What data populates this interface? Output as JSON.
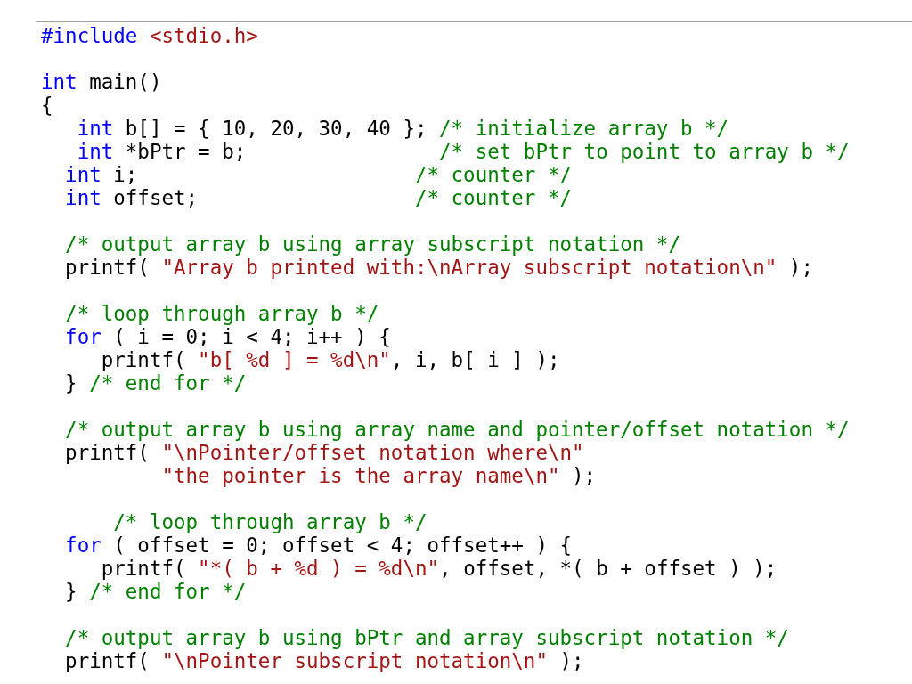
{
  "code_lines": [
    {
      "kind": "code",
      "tokens": [
        {
          "kind": "keyword",
          "text": "#include "
        },
        {
          "kind": "string",
          "text": "<stdio.h>"
        }
      ]
    },
    {
      "kind": "blank"
    },
    {
      "kind": "code",
      "tokens": [
        {
          "kind": "keyword",
          "text": "int"
        },
        {
          "kind": "plain",
          "text": " main()"
        }
      ]
    },
    {
      "kind": "code",
      "tokens": [
        {
          "kind": "plain",
          "text": "{"
        }
      ]
    },
    {
      "kind": "code",
      "tokens": [
        {
          "kind": "keyword",
          "text": "   int"
        },
        {
          "kind": "plain",
          "text": " b[] = { 10, 20, 30, 40 }; "
        },
        {
          "kind": "comment",
          "text": "/* initialize array b */"
        }
      ]
    },
    {
      "kind": "code",
      "tokens": [
        {
          "kind": "keyword",
          "text": "   int"
        },
        {
          "kind": "plain",
          "text": " *bPtr = b;                "
        },
        {
          "kind": "comment",
          "text": "/* set bPtr to point to array b */"
        }
      ]
    },
    {
      "kind": "code",
      "tokens": [
        {
          "kind": "keyword",
          "text": "  int"
        },
        {
          "kind": "plain",
          "text": " i;                       "
        },
        {
          "kind": "comment",
          "text": "/* counter */"
        }
      ]
    },
    {
      "kind": "code",
      "tokens": [
        {
          "kind": "keyword",
          "text": "  int"
        },
        {
          "kind": "plain",
          "text": " offset;                  "
        },
        {
          "kind": "comment",
          "text": "/* counter */"
        }
      ]
    },
    {
      "kind": "blank"
    },
    {
      "kind": "code",
      "tokens": [
        {
          "kind": "comment",
          "text": "  /* output array b using array subscript notation */"
        }
      ]
    },
    {
      "kind": "code",
      "tokens": [
        {
          "kind": "plain",
          "text": "  printf( "
        },
        {
          "kind": "string",
          "text": "\"Array b printed with:\\nArray subscript notation\\n\""
        },
        {
          "kind": "plain",
          "text": " );"
        }
      ]
    },
    {
      "kind": "blank"
    },
    {
      "kind": "code",
      "tokens": [
        {
          "kind": "comment",
          "text": "  /* loop through array b */"
        }
      ]
    },
    {
      "kind": "code",
      "tokens": [
        {
          "kind": "keyword",
          "text": "  for"
        },
        {
          "kind": "plain",
          "text": " ( i = 0; i < 4; i++ ) {"
        }
      ]
    },
    {
      "kind": "code",
      "tokens": [
        {
          "kind": "plain",
          "text": "     printf( "
        },
        {
          "kind": "string",
          "text": "\"b[ %d ] = %d\\n\""
        },
        {
          "kind": "plain",
          "text": ", i, b[ i ] );"
        }
      ]
    },
    {
      "kind": "code",
      "tokens": [
        {
          "kind": "plain",
          "text": "  } "
        },
        {
          "kind": "comment",
          "text": "/* end for */"
        }
      ]
    },
    {
      "kind": "blank"
    },
    {
      "kind": "code",
      "tokens": [
        {
          "kind": "comment",
          "text": "  /* output array b using array name and pointer/offset notation */"
        }
      ]
    },
    {
      "kind": "code",
      "tokens": [
        {
          "kind": "plain",
          "text": "  printf( "
        },
        {
          "kind": "string",
          "text": "\"\\nPointer/offset notation where\\n\""
        }
      ]
    },
    {
      "kind": "code",
      "tokens": [
        {
          "kind": "string",
          "text": "          \"the pointer is the array name\\n\""
        },
        {
          "kind": "plain",
          "text": " );"
        }
      ]
    },
    {
      "kind": "blank"
    },
    {
      "kind": "code",
      "tokens": [
        {
          "kind": "comment",
          "text": "      /* loop through array b */"
        }
      ]
    },
    {
      "kind": "code",
      "tokens": [
        {
          "kind": "keyword",
          "text": "  for"
        },
        {
          "kind": "plain",
          "text": " ( offset = 0; offset < 4; offset++ ) {"
        }
      ]
    },
    {
      "kind": "code",
      "tokens": [
        {
          "kind": "plain",
          "text": "     printf( "
        },
        {
          "kind": "string",
          "text": "\"*( b + %d ) = %d\\n\""
        },
        {
          "kind": "plain",
          "text": ", offset, *( b + offset ) );"
        }
      ]
    },
    {
      "kind": "code",
      "tokens": [
        {
          "kind": "plain",
          "text": "  } "
        },
        {
          "kind": "comment",
          "text": "/* end for */"
        }
      ]
    },
    {
      "kind": "blank"
    },
    {
      "kind": "code",
      "tokens": [
        {
          "kind": "comment",
          "text": "  /* output array b using bPtr and array subscript notation */"
        }
      ]
    },
    {
      "kind": "code",
      "tokens": [
        {
          "kind": "plain",
          "text": "  printf( "
        },
        {
          "kind": "string",
          "text": "\"\\nPointer subscript notation\\n\""
        },
        {
          "kind": "plain",
          "text": " );"
        }
      ]
    }
  ]
}
